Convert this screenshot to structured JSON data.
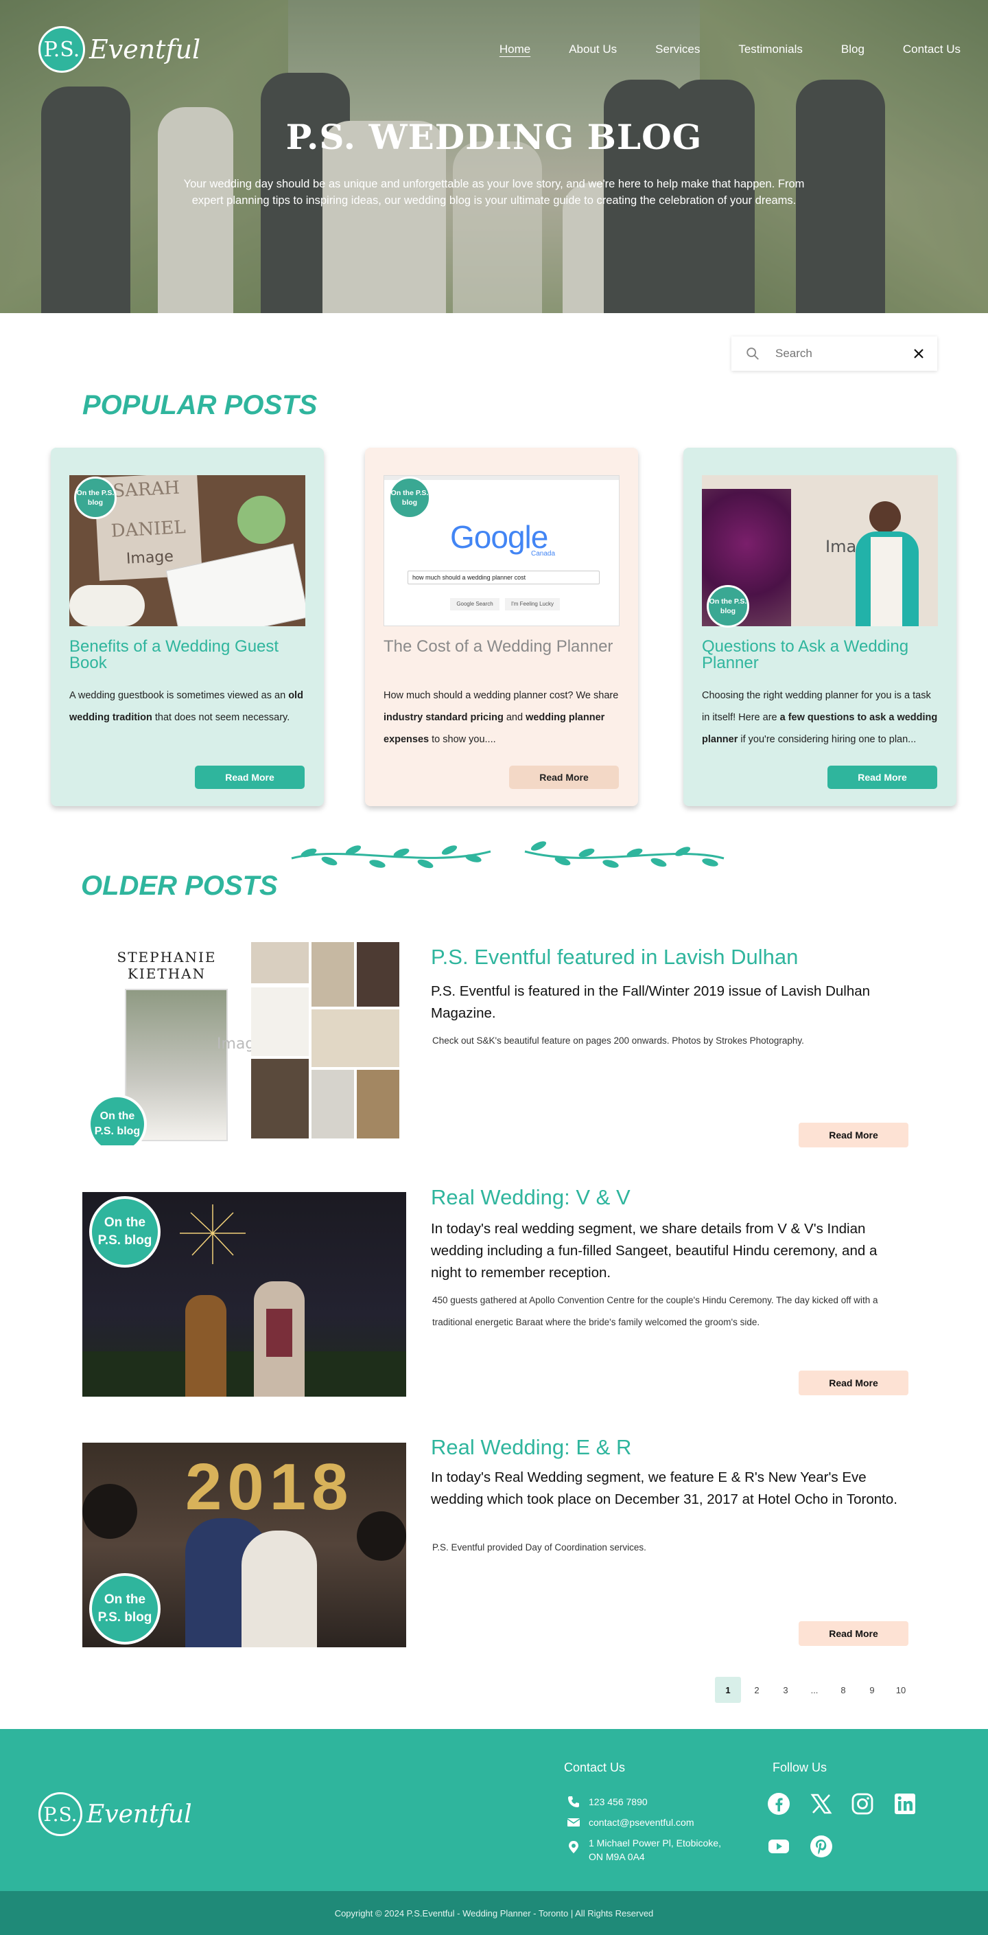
{
  "brand": {
    "initials": "P.S.",
    "wordmark": "Eventful"
  },
  "nav": {
    "items": [
      "Home",
      "About Us",
      "Services",
      "Testimonials",
      "Blog",
      "Contact Us"
    ],
    "active": "Home"
  },
  "hero": {
    "title": "P.S. WEDDING BLOG",
    "subtitle": "Your wedding day should be as unique and unforgettable as your love story, and we're here to help make that happen. From expert planning tips to inspiring ideas, our wedding blog is your ultimate guide to creating the celebration of your dreams."
  },
  "search": {
    "placeholder": "Search"
  },
  "popular": {
    "heading": "POPULAR POSTS",
    "badge": "On the P.S. blog",
    "cards": [
      {
        "title": "Benefits of a Wedding Guest Book",
        "excerpt_pre": "A wedding guestbook is sometimes viewed as an ",
        "excerpt_bold": "old wedding tradition",
        "excerpt_post": " that does not seem necessary.",
        "button": "Read More",
        "image_text": {
          "name1": "SARAH",
          "name2": "DANIEL",
          "image": "Image"
        }
      },
      {
        "title": "The Cost of a Wedding Planner",
        "excerpt_a": "How much should a wedding planner cost? We share ",
        "excerpt_b": "industry standard pricing",
        "excerpt_c": " and ",
        "excerpt_d": "wedding planner expenses",
        "excerpt_e": " to show you....",
        "button": "Read More",
        "image_text": {
          "logo": "Google",
          "region": "Canada",
          "query": "how much should a wedding planner cost",
          "btn1": "Google Search",
          "btn2": "I'm Feeling Lucky"
        }
      },
      {
        "title": "Questions to Ask a Wedding Planner",
        "excerpt_a": "Choosing the right wedding planner for you is a task in itself! Here are ",
        "excerpt_b": "a few questions to ask a wedding planner",
        "excerpt_c": " if you're considering hiring one to plan...",
        "button": "Read More",
        "image_text": {
          "image": "Image"
        }
      }
    ]
  },
  "older": {
    "heading": "OLDER POSTS",
    "badge": "On the P.S. blog",
    "posts": [
      {
        "title": "P.S. Eventful featured in Lavish Dulhan",
        "lead": "P.S. Eventful is featured in the Fall/Winter 2019 issue of Lavish Dulhan Magazine.",
        "body": "Check out S&K's beautiful feature on pages 200 onwards. Photos by Strokes Photography.",
        "button": "Read More",
        "image_text": {
          "magazine_name": "STEPHANIE KIETHAN",
          "image": "Image"
        }
      },
      {
        "title": "Real Wedding: V & V",
        "lead": "In today's real wedding segment, we share details from V & V's Indian wedding including a fun-filled Sangeet, beautiful Hindu ceremony, and a night to remember reception.",
        "body": "450 guests gathered at Apollo Convention Centre for the couple's Hindu Ceremony. The day kicked off with a traditional energetic Baraat where the bride's family welcomed the groom's side.",
        "button": "Read More"
      },
      {
        "title": "Real Wedding: E & R",
        "lead": "In today's Real Wedding segment, we feature E & R's New Year's Eve wedding which took place on December 31, 2017 at Hotel Ocho in Toronto.",
        "body": "P.S. Eventful provided Day of Coordination services.",
        "button": "Read More",
        "image_text": {
          "balloons": "2018"
        }
      }
    ]
  },
  "pagination": {
    "pages": [
      "1",
      "2",
      "3",
      "...",
      "8",
      "9",
      "10"
    ],
    "active": "1"
  },
  "footer": {
    "contact_heading": "Contact Us",
    "phone": "123 456 7890",
    "email": "contact@pseventful.com",
    "address_line1": "1 Michael Power Pl, Etobicoke,",
    "address_line2": "ON M9A 0A4",
    "follow_heading": "Follow Us",
    "social": [
      "facebook-icon",
      "x-icon",
      "instagram-icon",
      "linkedin-icon",
      "youtube-icon",
      "pinterest-icon"
    ],
    "copyright": "Copyright © 2024  P.S.Eventful - Wedding Planner - Toronto | All Rights Reserved"
  },
  "colors": {
    "teal": "#2fb59d",
    "mint": "#d8efe9",
    "peach": "#fcefe8",
    "peach_button": "#fde2d4",
    "dark_teal": "#1f8a78"
  }
}
